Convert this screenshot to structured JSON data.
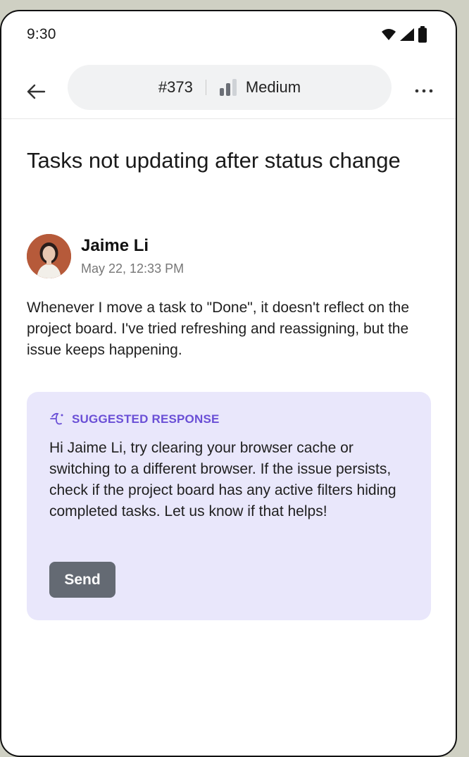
{
  "status_bar": {
    "time": "9:30",
    "icons": [
      "wifi-icon",
      "cell-signal-icon",
      "battery-icon"
    ]
  },
  "header": {
    "back_icon": "arrow-left-icon",
    "ticket_id": "#373",
    "priority": {
      "icon": "priority-bars-icon",
      "label": "Medium",
      "level_filled": 2,
      "level_total": 3
    },
    "more_icon": "more-horizontal-icon"
  },
  "ticket": {
    "title": "Tasks not updating after status change",
    "author": {
      "name": "Jaime Li",
      "timestamp": "May 22, 12:33 PM"
    },
    "message": "Whenever I move a task to \"Done\", it doesn't reflect on the project board. I've tried refreshing and reassigning, but the issue keeps happening."
  },
  "suggested_response": {
    "icon": "sparkle-script-icon",
    "label": "SUGGESTED RESPONSE",
    "text": "Hi Jaime Li, try clearing your browser cache or switching to a different browser. If the issue persists, check if the project board has any active filters hiding completed tasks. Let us know if that helps!",
    "send_label": "Send"
  },
  "colors": {
    "background": "#cfd0c3",
    "card_background": "#e9e7fb",
    "accent_purple": "#6a4fd6",
    "send_button": "#646a73",
    "pill_background": "#f1f2f3"
  }
}
